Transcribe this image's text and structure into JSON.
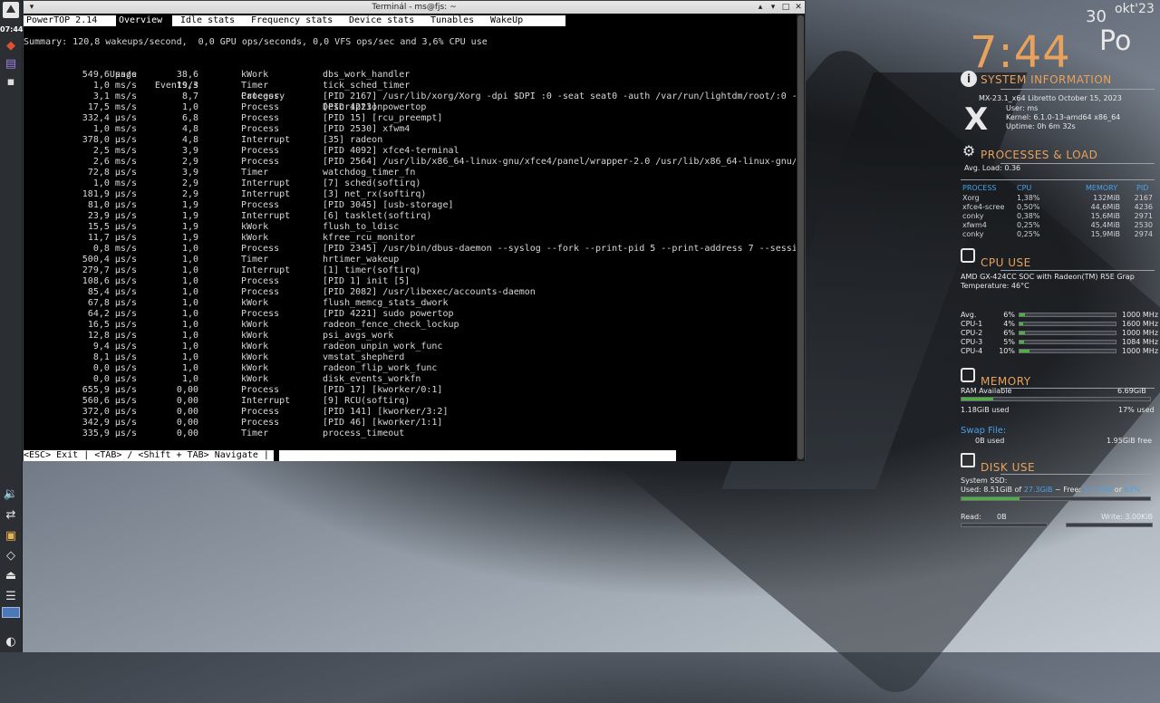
{
  "window": {
    "title": "Terminál - ms@fjs: ~",
    "menu_btn": "▾",
    "btn_up": "▴",
    "btn_min": "▾",
    "btn_max": "□",
    "btn_close": "✕"
  },
  "powertop": {
    "brand": "PowerTOP 2.14",
    "tabs": [
      "Overview",
      "Idle stats",
      "Frequency stats",
      "Device stats",
      "Tunables",
      "WakeUp"
    ],
    "summary": "Summary: 120,8 wakeups/second,  0,0 GPU ops/seconds, 0,0 VFS ops/sec and 3,6% CPU use",
    "headers": [
      "Usage",
      "Events/s",
      "Category",
      "Description"
    ],
    "rows": [
      [
        "549,6 µs/s",
        "38,6",
        "kWork",
        "dbs_work_handler"
      ],
      [
        "1,0 ms/s",
        "19,3",
        "Timer",
        "tick_sched_timer"
      ],
      [
        "3,1 ms/s",
        "8,7",
        "Process",
        "[PID 2167] /usr/lib/xorg/Xorg -dpi $DPI :0 -seat seat0 -auth /var/run/lightdm/root/:0 -"
      ],
      [
        "17,5 ms/s",
        "1,0",
        "Process",
        "[PID 4223] powertop"
      ],
      [
        "332,4 µs/s",
        "6,8",
        "Process",
        "[PID 15] [rcu_preempt]"
      ],
      [
        "1,0 ms/s",
        "4,8",
        "Process",
        "[PID 2530] xfwm4"
      ],
      [
        "378,0 µs/s",
        "4,8",
        "Interrupt",
        "[35] radeon"
      ],
      [
        "2,5 ms/s",
        "3,9",
        "Process",
        "[PID 4092] xfce4-terminal"
      ],
      [
        "2,6 ms/s",
        "2,9",
        "Process",
        "[PID 2564] /usr/lib/x86_64-linux-gnu/xfce4/panel/wrapper-2.0 /usr/lib/x86_64-linux-gnu/"
      ],
      [
        "72,8 µs/s",
        "3,9",
        "Timer",
        "watchdog_timer_fn"
      ],
      [
        "1,0 ms/s",
        "2,9",
        "Interrupt",
        "[7] sched(softirq)"
      ],
      [
        "181,9 µs/s",
        "2,9",
        "Interrupt",
        "[3] net_rx(softirq)"
      ],
      [
        "81,0 µs/s",
        "1,9",
        "Process",
        "[PID 3045] [usb-storage]"
      ],
      [
        "23,9 µs/s",
        "1,9",
        "Interrupt",
        "[6] tasklet(softirq)"
      ],
      [
        "15,5 µs/s",
        "1,9",
        "kWork",
        "flush_to_ldisc"
      ],
      [
        "11,7 µs/s",
        "1,9",
        "kWork",
        "kfree_rcu_monitor"
      ],
      [
        "0,8 ms/s",
        "1,0",
        "Process",
        "[PID 2345] /usr/bin/dbus-daemon --syslog --fork --print-pid 5 --print-address 7 --sessi"
      ],
      [
        "500,4 µs/s",
        "1,0",
        "Timer",
        "hrtimer_wakeup"
      ],
      [
        "279,7 µs/s",
        "1,0",
        "Interrupt",
        "[1] timer(softirq)"
      ],
      [
        "108,6 µs/s",
        "1,0",
        "Process",
        "[PID 1] init [5]"
      ],
      [
        "85,4 µs/s",
        "1,0",
        "Process",
        "[PID 2082] /usr/libexec/accounts-daemon"
      ],
      [
        "67,8 µs/s",
        "1,0",
        "kWork",
        "flush_memcg_stats_dwork"
      ],
      [
        "64,2 µs/s",
        "1,0",
        "Process",
        "[PID 4221] sudo powertop"
      ],
      [
        "16,5 µs/s",
        "1,0",
        "kWork",
        "radeon_fence_check_lockup"
      ],
      [
        "12,8 µs/s",
        "1,0",
        "kWork",
        "psi_avgs_work"
      ],
      [
        "9,4 µs/s",
        "1,0",
        "kWork",
        "radeon_unpin_work_func"
      ],
      [
        "8,1 µs/s",
        "1,0",
        "kWork",
        "vmstat_shepherd"
      ],
      [
        "0,0 µs/s",
        "1,0",
        "kWork",
        "radeon_flip_work_func"
      ],
      [
        "0,0 µs/s",
        "1,0",
        "kWork",
        "disk_events_workfn"
      ],
      [
        "655,9 µs/s",
        "0,00",
        "Process",
        "[PID 17] [kworker/0:1]"
      ],
      [
        "560,6 µs/s",
        "0,00",
        "Interrupt",
        "[9] RCU(softirq)"
      ],
      [
        "372,0 µs/s",
        "0,00",
        "Process",
        "[PID 141] [kworker/3:2]"
      ],
      [
        "342,9 µs/s",
        "0,00",
        "Process",
        "[PID 46] [kworker/1:1]"
      ],
      [
        "335,9 µs/s",
        "0,00",
        "Timer",
        "process_timeout"
      ]
    ],
    "footer": "<ESC> Exit | <TAB> / <Shift + TAB> Navigate | "
  },
  "panel": {
    "clock": "07:44"
  },
  "conky": {
    "time": "7:44",
    "day": "30",
    "weekday": "Po",
    "month": "okt'23",
    "sysinfo": {
      "title": "SYSTEM INFORMATION",
      "distro": "MX-23.1_x64 Libretto October 15, 2023",
      "user": "User: ms",
      "kernel": "Kernel: 6.1.0-13-amd64 x86_64",
      "uptime": "Uptime: 0h 6m 32s"
    },
    "processes": {
      "title": "PROCESSES & LOAD",
      "avg_load": "Avg. Load: 0.36",
      "head": [
        "PROCESS",
        "CPU",
        "MEMORY",
        "PID"
      ],
      "rows": [
        [
          "Xorg",
          "1,38%",
          "132MiB",
          "2167"
        ],
        [
          "xfce4-scree",
          "0,50%",
          "44,6MiB",
          "4236"
        ],
        [
          "conky",
          "0,38%",
          "15,6MiB",
          "2971"
        ],
        [
          "xfwm4",
          "0,25%",
          "45,4MiB",
          "2530"
        ],
        [
          "conky",
          "0,25%",
          "15,9MiB",
          "2974"
        ]
      ]
    },
    "cpu": {
      "title": "CPU USE",
      "model": "AMD GX-424CC SOC with Radeon(TM) R5E Grap",
      "temp": "Temperature: 46°C",
      "cores": [
        {
          "name": "Avg.",
          "pct": "6%",
          "level": 0.06,
          "freq": "1000 MHz"
        },
        {
          "name": "CPU-1",
          "pct": "4%",
          "level": 0.04,
          "freq": "1600 MHz"
        },
        {
          "name": "CPU-2",
          "pct": "6%",
          "level": 0.06,
          "freq": "1000 MHz"
        },
        {
          "name": "CPU-3",
          "pct": "5%",
          "level": 0.05,
          "freq": "1084 MHz"
        },
        {
          "name": "CPU-4",
          "pct": "10%",
          "level": 0.1,
          "freq": "1000 MHz"
        }
      ]
    },
    "memory": {
      "title": "MEMORY",
      "ram_label": "RAM Available",
      "ram_avail": "6.69GiB",
      "used": "1.18GiB used",
      "used_pct": "17% used",
      "level": 0.17,
      "swap_label": "Swap File:",
      "swap_used": "0B used",
      "swap_free": "1.95GiB free"
    },
    "disk": {
      "title": "DISK USE",
      "ssd": "System SSD:",
      "used_prefix": "Used: 8.51GiB of ",
      "total": "27.3GiB",
      "free_prefix": " ~ Free: ",
      "free": "17.3GiB",
      "or": " or ",
      "free_pct": "63%",
      "level": 0.31,
      "read_label": "Read:",
      "read_val": "0B",
      "write": "Write: 3.00KiB"
    },
    "colors": {
      "accent": "#e8a25c",
      "label_blue": "#4aa0e6",
      "bar_fill": "#4caf3f"
    }
  }
}
